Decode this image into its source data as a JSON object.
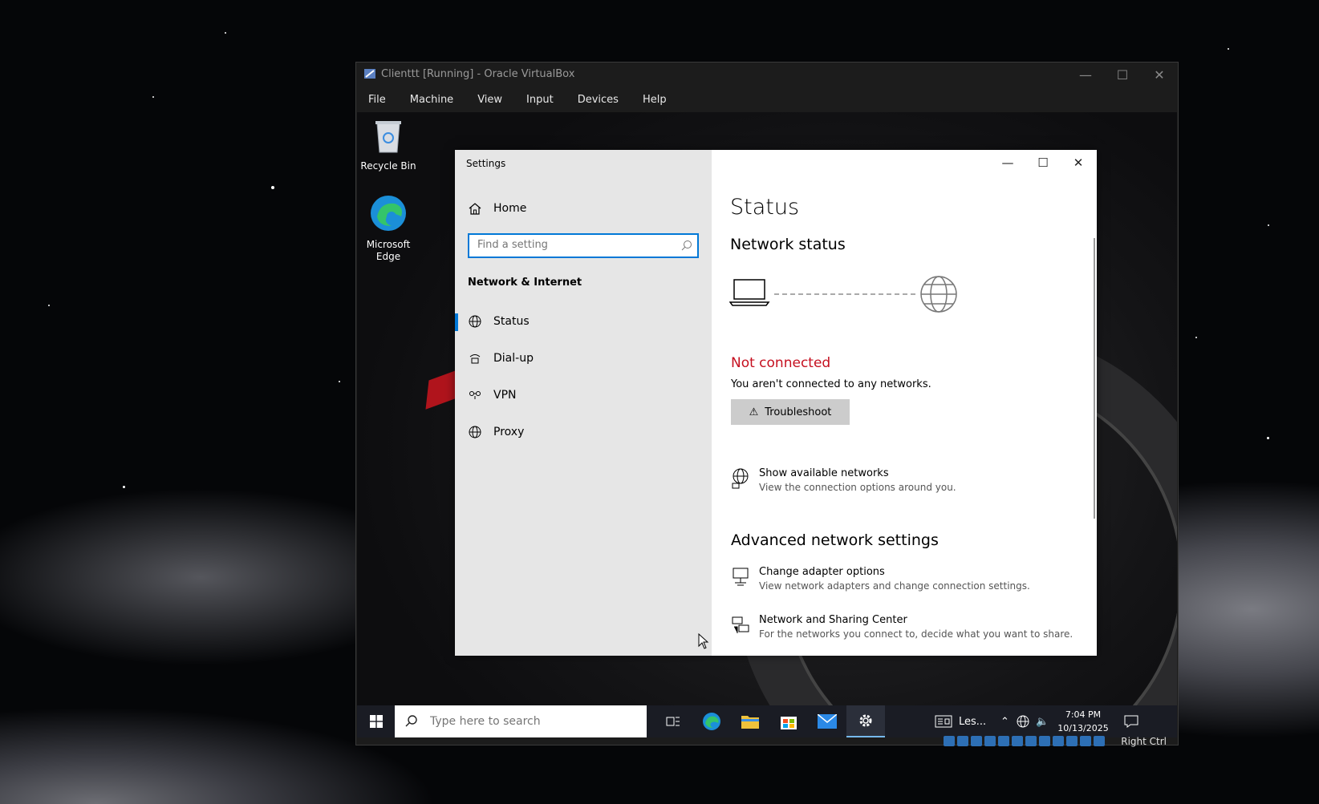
{
  "vbox": {
    "title": "Clienttt [Running] - Oracle VirtualBox",
    "menu": [
      "File",
      "Machine",
      "View",
      "Input",
      "Devices",
      "Help"
    ],
    "host_key": "Right Ctrl"
  },
  "desktop": {
    "icons": [
      {
        "label": "Recycle Bin",
        "icon": "recycle-bin-icon"
      },
      {
        "label": "Microsoft Edge",
        "icon": "edge-icon"
      }
    ]
  },
  "settings": {
    "title": "Settings",
    "home": "Home",
    "search_placeholder": "Find a setting",
    "section": "Network & Internet",
    "nav": [
      {
        "label": "Status",
        "icon": "globe-status-icon",
        "selected": true
      },
      {
        "label": "Dial-up",
        "icon": "dialup-icon",
        "selected": false
      },
      {
        "label": "VPN",
        "icon": "vpn-icon",
        "selected": false
      },
      {
        "label": "Proxy",
        "icon": "proxy-globe-icon",
        "selected": false
      }
    ],
    "page_title": "Status",
    "network_status": "Network status",
    "not_connected": "Not connected",
    "not_connected_sub": "You aren't connected to any networks.",
    "troubleshoot": "Troubleshoot",
    "show_networks": {
      "title": "Show available networks",
      "sub": "View the connection options around you."
    },
    "advanced_heading": "Advanced network settings",
    "adapter": {
      "title": "Change adapter options",
      "sub": "View network adapters and change connection settings."
    },
    "sharing": {
      "title": "Network and Sharing Center",
      "sub": "For the networks you connect to, decide what you want to share."
    },
    "accent": "#0078d7",
    "error_color": "#c50f1f"
  },
  "taskbar": {
    "search_placeholder": "Type here to search",
    "news": "Les...",
    "time": "7:04 PM",
    "date": "10/13/2025"
  }
}
